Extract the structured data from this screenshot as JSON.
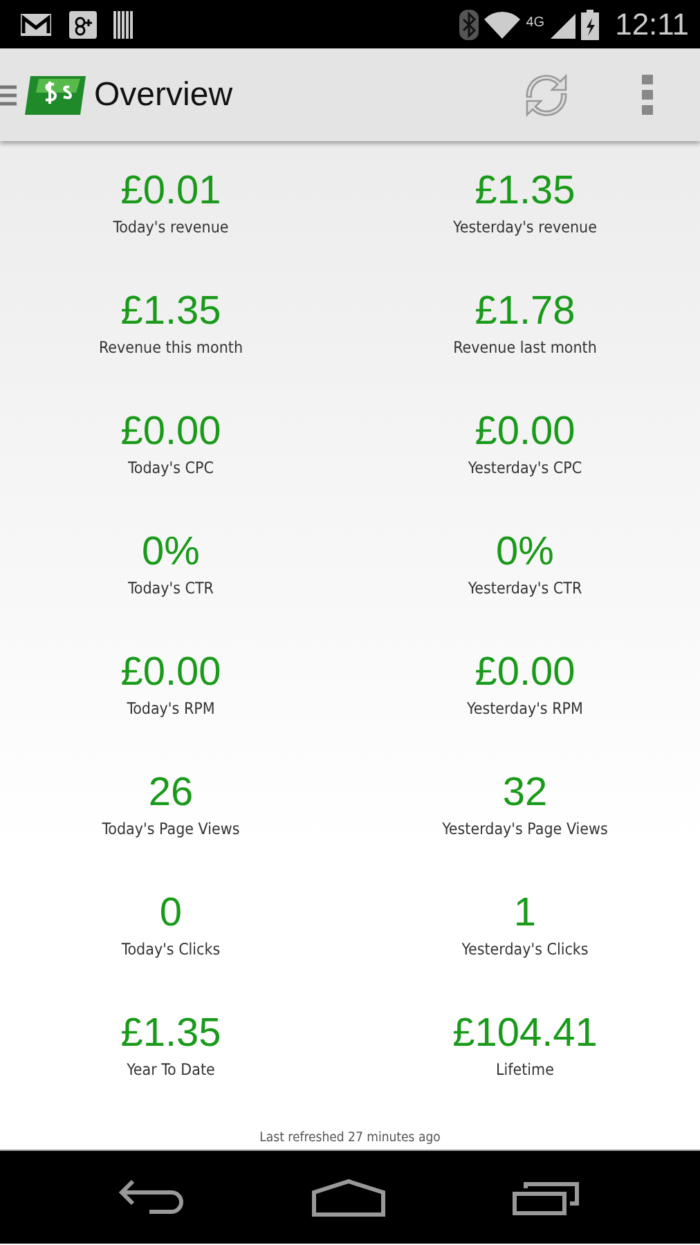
{
  "status_bar": {
    "time": "12:11",
    "network": "4G"
  },
  "action_bar": {
    "title": "Overview"
  },
  "stats": [
    {
      "value": "£0.01",
      "label": "Today's revenue"
    },
    {
      "value": "£1.35",
      "label": "Yesterday's revenue"
    },
    {
      "value": "£1.35",
      "label": "Revenue this month"
    },
    {
      "value": "£1.78",
      "label": "Revenue last month"
    },
    {
      "value": "£0.00",
      "label": "Today's CPC"
    },
    {
      "value": "£0.00",
      "label": "Yesterday's CPC"
    },
    {
      "value": "0%",
      "label": "Today's CTR"
    },
    {
      "value": "0%",
      "label": "Yesterday's CTR"
    },
    {
      "value": "£0.00",
      "label": "Today's RPM"
    },
    {
      "value": "£0.00",
      "label": "Yesterday's RPM"
    },
    {
      "value": "26",
      "label": "Today's Page Views"
    },
    {
      "value": "32",
      "label": "Yesterday's Page Views"
    },
    {
      "value": "0",
      "label": "Today's Clicks"
    },
    {
      "value": "1",
      "label": "Yesterday's Clicks"
    },
    {
      "value": "£1.35",
      "label": "Year To Date"
    },
    {
      "value": "£104.41",
      "label": "Lifetime"
    }
  ],
  "footer": "Last refreshed 27 minutes ago"
}
